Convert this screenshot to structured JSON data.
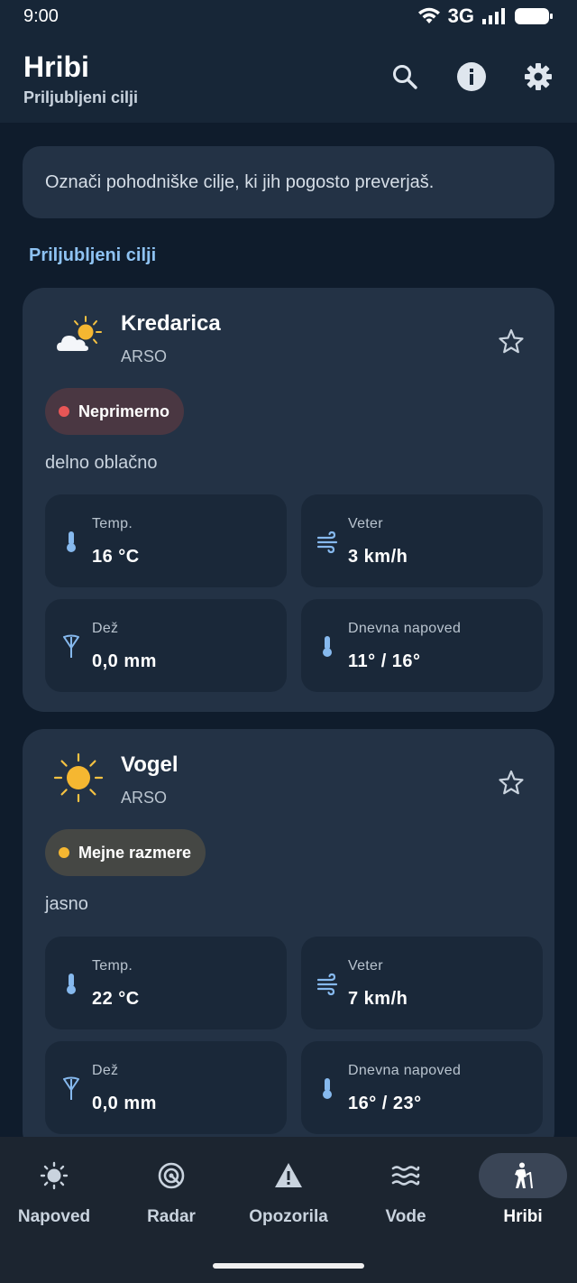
{
  "status_bar": {
    "time": "9:00",
    "network": "3G"
  },
  "app_bar": {
    "title": "Hribi",
    "subtitle": "Priljubljeni cilji"
  },
  "hint": "Označi pohodniške cilje, ki jih pogosto preverjaš.",
  "section_label": "Priljubljeni cilji",
  "cards": [
    {
      "name": "Kredarica",
      "source": "ARSO",
      "icon": "partly-cloudy-icon",
      "badge": {
        "label": "Neprimerno",
        "dot_color": "#e85656",
        "bg_color": "#4a3742"
      },
      "condition": "delno oblačno",
      "stats": [
        {
          "label": "Temp.",
          "value": "16 °C",
          "icon": "thermometer-icon"
        },
        {
          "label": "Veter",
          "value": "3 km/h",
          "icon": "wind-icon"
        },
        {
          "label": "Dež",
          "value": "0,0 mm",
          "icon": "umbrella-icon"
        },
        {
          "label": "Dnevna napoved",
          "value": "11° / 16°",
          "icon": "thermometer-icon"
        }
      ]
    },
    {
      "name": "Vogel",
      "source": "ARSO",
      "icon": "sun-icon",
      "badge": {
        "label": "Mejne razmere",
        "dot_color": "#f5b731",
        "bg_color": "#454744"
      },
      "condition": "jasno",
      "stats": [
        {
          "label": "Temp.",
          "value": "22 °C",
          "icon": "thermometer-icon"
        },
        {
          "label": "Veter",
          "value": "7 km/h",
          "icon": "wind-icon"
        },
        {
          "label": "Dež",
          "value": "0,0 mm",
          "icon": "umbrella-icon"
        },
        {
          "label": "Dnevna napoved",
          "value": "16° / 23°",
          "icon": "thermometer-icon"
        }
      ]
    }
  ],
  "nav": [
    {
      "label": "Napoved",
      "icon": "sun-outline-icon",
      "active": false
    },
    {
      "label": "Radar",
      "icon": "radar-icon",
      "active": false
    },
    {
      "label": "Opozorila",
      "icon": "warning-icon",
      "active": false
    },
    {
      "label": "Vode",
      "icon": "waves-icon",
      "active": false
    },
    {
      "label": "Hribi",
      "icon": "hiking-icon",
      "active": true
    }
  ],
  "colors": {
    "accent": "#8ec2f2",
    "background": "#0f1c2c",
    "card": "#233245",
    "stat_tile": "#1a2839",
    "icon_blue": "#86b9ee"
  }
}
